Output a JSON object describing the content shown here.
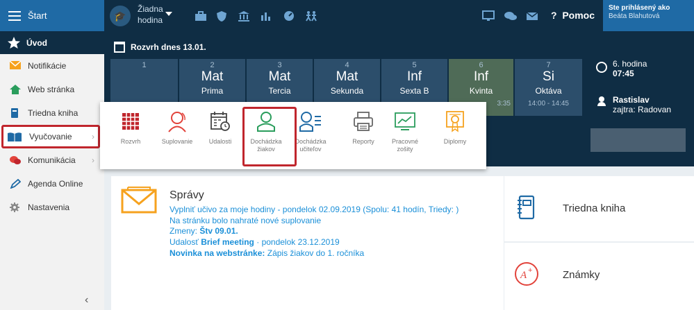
{
  "topbar": {
    "start_label": "Štart",
    "hour_line1": "Žiadna",
    "hour_line2": "hodina",
    "help_label": "Pomoc",
    "user_line1": "Ste prihlásený ako",
    "user_line2": "Beáta Blahutová"
  },
  "sidebar": {
    "items": [
      {
        "label": "Úvod"
      },
      {
        "label": "Notifikácie"
      },
      {
        "label": "Web stránka"
      },
      {
        "label": "Triedna kniha"
      },
      {
        "label": "Vyučovanie"
      },
      {
        "label": "Komunikácia"
      },
      {
        "label": "Agenda Online"
      },
      {
        "label": "Nastavenia"
      }
    ]
  },
  "schedule": {
    "title": "Rozvrh dnes 13.01.",
    "columns": [
      {
        "num": "1",
        "subject": "",
        "class": "",
        "time": ""
      },
      {
        "num": "2",
        "subject": "Mat",
        "class": "Prima",
        "time": ""
      },
      {
        "num": "3",
        "subject": "Mat",
        "class": "Tercia",
        "time": ""
      },
      {
        "num": "4",
        "subject": "Mat",
        "class": "Sekunda",
        "time": ""
      },
      {
        "num": "5",
        "subject": "Inf",
        "class": "Sexta B",
        "time": ""
      },
      {
        "num": "6",
        "subject": "Inf",
        "class": "Kvinta",
        "time": "3:35"
      },
      {
        "num": "7",
        "subject": "Si",
        "class": "Oktáva",
        "time": "14:00 - 14:45"
      }
    ],
    "current_hour": "6. hodina",
    "current_time": "07:45",
    "person_name": "Rastislav",
    "tomorrow": "zajtra: Radovan"
  },
  "popup": {
    "items": [
      {
        "line1": "Rozvrh",
        "line2": ""
      },
      {
        "line1": "Suplovanie",
        "line2": ""
      },
      {
        "line1": "Udalosti",
        "line2": ""
      },
      {
        "line1": "Dochádzka",
        "line2": "žiakov"
      },
      {
        "line1": "Dochádzka",
        "line2": "učiteľov"
      },
      {
        "line1": "Reporty",
        "line2": ""
      },
      {
        "line1": "Pracovné",
        "line2": "zošity"
      },
      {
        "line1": "Diplomy",
        "line2": ""
      }
    ]
  },
  "spravy": {
    "title": "Správy",
    "line1": "Vyplniť učivo za moje hodiny - pondelok 02.09.2019 (Spolu: 41 hodín, Triedy: )",
    "line2": "Na stránku bolo nahraté nové suplovanie",
    "line3_prefix": "Zmeny:",
    "line3_bold": "Štv 09.01.",
    "line4_prefix": "Udalosť",
    "line4_bold": "Brief meeting",
    "line4_suffix": "· pondelok 23.12.2019",
    "line5_bold": "Novinka na webstránke:",
    "line5_suffix": "Zápis žiakov do 1. ročníka"
  },
  "right_cards": {
    "card1": "Triedna kniha",
    "card2": "Známky"
  },
  "colors": {
    "navy": "#0f2d44",
    "blue": "#1f6aa5",
    "link": "#1a8fd8",
    "highlight": "#c0262d",
    "orange": "#f6a21e"
  }
}
